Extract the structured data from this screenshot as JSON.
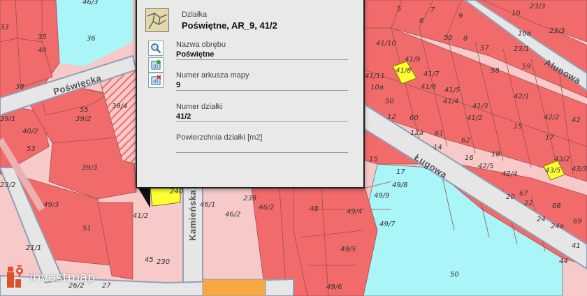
{
  "popup": {
    "header_label": "Działka",
    "header_title": "Poświętne, AR_9, 41/2",
    "fields": [
      {
        "label": "Nazwa obrębu",
        "value": "Poświętne"
      },
      {
        "label": "Numer arkusza mapy",
        "value": "9"
      },
      {
        "label": "Numer działki",
        "value": "41/2"
      },
      {
        "label": "Powierzchnia działki [m2]",
        "value": ""
      }
    ],
    "tools": [
      "zoom-to-icon",
      "add-parcel-icon",
      "remove-parcel-icon"
    ]
  },
  "streets": [
    "Poświęcka",
    "Kamieńska",
    "Ługowa",
    "Alunowa"
  ],
  "parcels": [
    "33",
    "32",
    "35",
    "40",
    "38",
    "36",
    "46/3",
    "25",
    "39/4",
    "55",
    "39/2",
    "40/2",
    "53",
    "39/3",
    "49/3",
    "51",
    "39/1",
    "41/2",
    "240",
    "230",
    "45",
    "46/1",
    "239",
    "46/2",
    "48",
    "49/4",
    "49/5",
    "49/6",
    "49/7",
    "49/8",
    "49/9",
    "17",
    "15",
    "50",
    "12",
    "12a",
    "60",
    "61",
    "14",
    "62",
    "63",
    "16",
    "18",
    "42/5",
    "42/4",
    "20",
    "22",
    "24",
    "24a",
    "67",
    "68",
    "69",
    "43/2",
    "43/3",
    "43/5",
    "15",
    "17",
    "42/2",
    "42/1",
    "58",
    "59",
    "57",
    "50",
    "41/10",
    "41/11",
    "10a",
    "41/8",
    "41/7",
    "41/6",
    "41/5",
    "41/4",
    "41/3",
    "41/2",
    "5",
    "6",
    "7",
    "8",
    "9",
    "10",
    "10a",
    "23/3",
    "23/1",
    "23/2",
    "50",
    "44",
    "21/1",
    "26/2",
    "27",
    "41"
  ],
  "logo": {
    "text": "investmap"
  },
  "colors": {
    "parcel": "#f26b6b",
    "water": "#a9f5f7",
    "road": "#e6e6e6",
    "highlight": "#ffff33",
    "building": "#ffd0d0"
  }
}
